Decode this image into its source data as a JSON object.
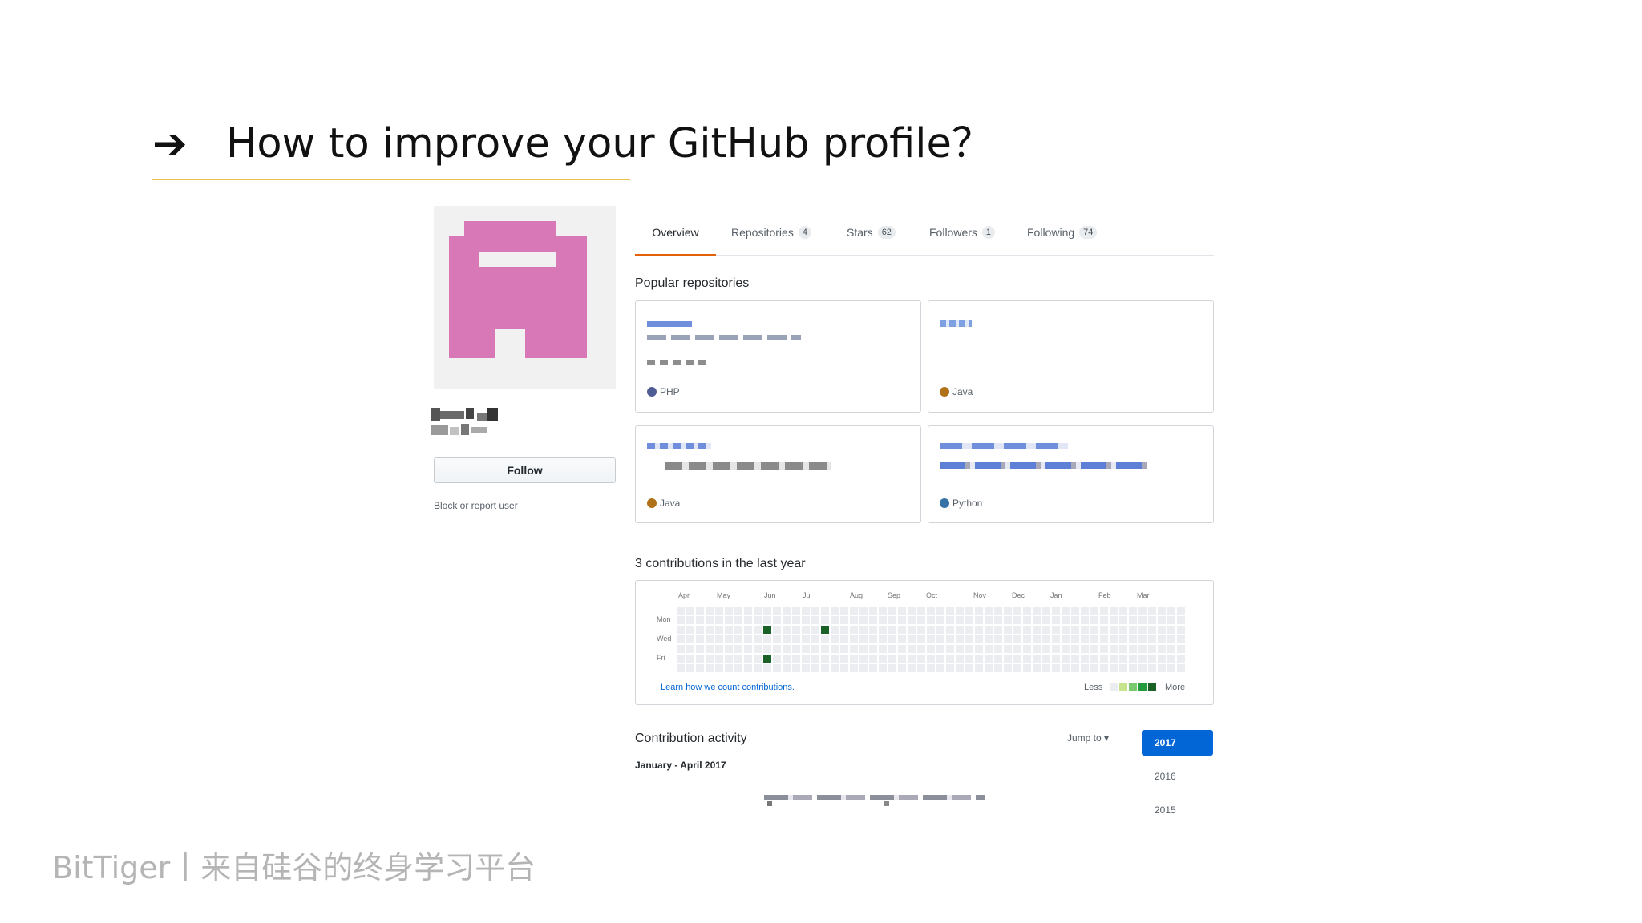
{
  "slide": {
    "arrow": "➔",
    "title": "How to improve your GitHub profile？",
    "footer": "BitTiger丨来自硅谷的终身学习平台"
  },
  "profile": {
    "follow_label": "Follow",
    "block_label": "Block or report user",
    "avatar_color": "#d978b6"
  },
  "tabs": [
    {
      "label": "Overview",
      "count": null,
      "selected": true
    },
    {
      "label": "Repositories",
      "count": "4"
    },
    {
      "label": "Stars",
      "count": "62"
    },
    {
      "label": "Followers",
      "count": "1"
    },
    {
      "label": "Following",
      "count": "74"
    }
  ],
  "popular": {
    "heading": "Popular repositories",
    "repos": [
      {
        "language": "PHP",
        "color": "#4f5d95"
      },
      {
        "language": "Java",
        "color": "#b07219"
      },
      {
        "language": "Java",
        "color": "#b07219"
      },
      {
        "language": "Python",
        "color": "#3572a5"
      }
    ]
  },
  "contributions": {
    "heading": "3 contributions in the last year",
    "months": [
      "Apr",
      "May",
      "Jun",
      "Jul",
      "Aug",
      "Sep",
      "Oct",
      "Nov",
      "Dec",
      "Jan",
      "Feb",
      "Mar"
    ],
    "days": [
      "Mon",
      "Wed",
      "Fri"
    ],
    "learn_link": "Learn how we count contributions.",
    "legend_less": "Less",
    "legend_more": "More",
    "legend_colors": [
      "#ebedf0",
      "#c6e48b",
      "#7bc96f",
      "#239a3b",
      "#196127"
    ],
    "empty_color": "#ebedf0",
    "active_color": "#196127",
    "active_cells": [
      {
        "week": 9,
        "day": 2
      },
      {
        "week": 9,
        "day": 5
      },
      {
        "week": 15,
        "day": 2
      }
    ]
  },
  "activity": {
    "heading": "Contribution activity",
    "jump_to": "Jump to ▾",
    "period": "January - April 2017",
    "years": [
      "2017",
      "2016",
      "2015"
    ],
    "active_year": "2017"
  }
}
